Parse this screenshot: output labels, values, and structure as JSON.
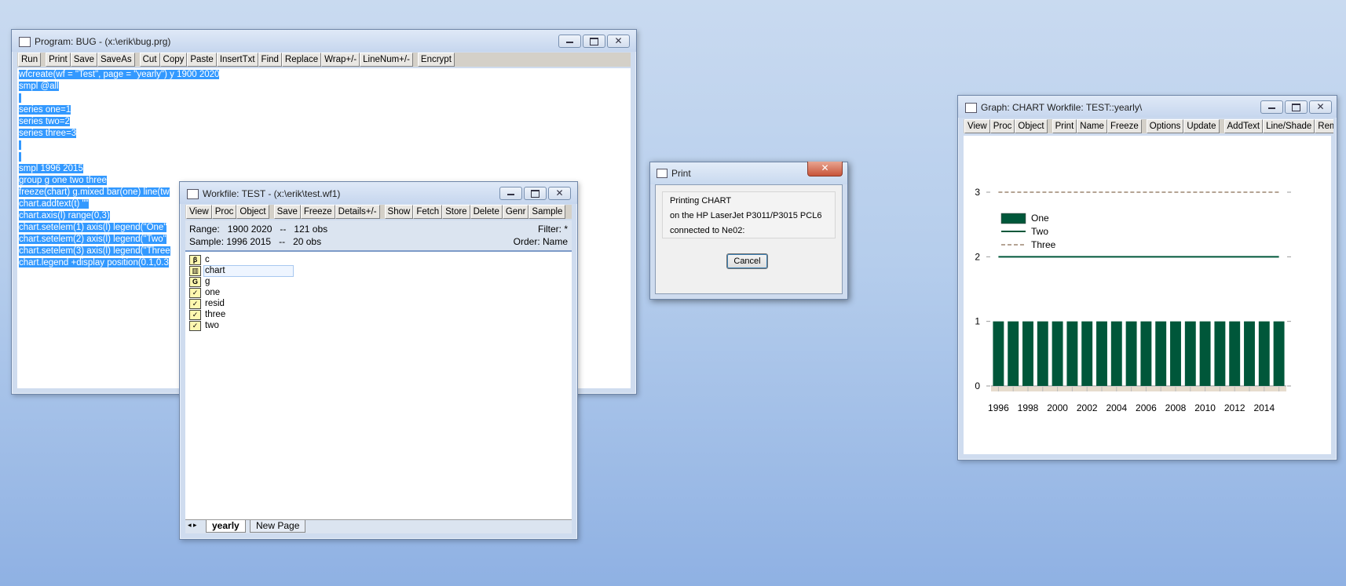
{
  "program": {
    "title": "Program: BUG - (x:\\erik\\bug.prg)",
    "toolbar": [
      "Run",
      "Print",
      "Save",
      "SaveAs",
      "Cut",
      "Copy",
      "Paste",
      "InsertTxt",
      "Find",
      "Replace",
      "Wrap+/-",
      "LineNum+/-",
      "Encrypt"
    ],
    "lines": [
      "wfcreate(wf = \"Test\", page = \"yearly\") y 1900 2020",
      "smpl @all",
      " ",
      "series one=1",
      "series two=2",
      "series three=3",
      " ",
      " ",
      "smpl 1996 2015",
      "group g one two three",
      "freeze(chart) g.mixed bar(one) line(tw",
      "chart.addtext(t) \"\"",
      "chart.axis(l) range(0,3)",
      "chart.setelem(1) axis(l) legend(\"One\"",
      "chart.setelem(2) axis(l) legend(\"Two\"",
      "chart.setelem(3) axis(l) legend(\"Three",
      "chart.legend +display position(0.1,0.3"
    ]
  },
  "workfile": {
    "title": "Workfile: TEST - (x:\\erik\\test.wf1)",
    "toolbar": [
      "View",
      "Proc",
      "Object",
      "Save",
      "Freeze",
      "Details+/-",
      "Show",
      "Fetch",
      "Store",
      "Delete",
      "Genr",
      "Sample"
    ],
    "range_text": "Range:   1900 2020   --   121 obs",
    "filter_text": "Filter: *",
    "sample_text": "Sample: 1996 2015   --   20 obs",
    "order_text": "Order: Name",
    "objects": [
      {
        "icon": "β",
        "name": "c",
        "icon_name": "coefficient-icon"
      },
      {
        "icon": "▥",
        "name": "chart",
        "icon_name": "graph-icon"
      },
      {
        "icon": "G",
        "name": "g",
        "icon_name": "group-icon"
      },
      {
        "icon": "✓",
        "name": "one",
        "icon_name": "series-icon"
      },
      {
        "icon": "✓",
        "name": "resid",
        "icon_name": "series-icon"
      },
      {
        "icon": "✓",
        "name": "three",
        "icon_name": "series-icon"
      },
      {
        "icon": "✓",
        "name": "two",
        "icon_name": "series-icon"
      }
    ],
    "tabs": [
      "yearly",
      "New Page"
    ]
  },
  "print_dialog": {
    "title": "Print",
    "line1": "Printing CHART",
    "line2": "on the HP LaserJet P3011/P3015 PCL6",
    "line3": "connected to Ne02:",
    "cancel_label": "Cancel"
  },
  "graph": {
    "title": "Graph: CHART   Workfile: TEST::yearly\\",
    "toolbar": [
      "View",
      "Proc",
      "Object",
      "Print",
      "Name",
      "Freeze",
      "Options",
      "Update",
      "AddText",
      "Line/Shade",
      "Remo"
    ]
  },
  "colors": {
    "bar": "#00573a",
    "line_two": "#00573a",
    "line_three": "#6b4a2a",
    "selection": "#3399ff"
  },
  "chart_data": {
    "type": "bar",
    "categories": [
      "1996",
      "1997",
      "1998",
      "1999",
      "2000",
      "2001",
      "2002",
      "2003",
      "2004",
      "2005",
      "2006",
      "2007",
      "2008",
      "2009",
      "2010",
      "2011",
      "2012",
      "2013",
      "2014",
      "2015"
    ],
    "xtick_labels": [
      "1996",
      "1998",
      "2000",
      "2002",
      "2004",
      "2006",
      "2008",
      "2010",
      "2012",
      "2014"
    ],
    "series": [
      {
        "name": "One",
        "type": "bar",
        "values": [
          1,
          1,
          1,
          1,
          1,
          1,
          1,
          1,
          1,
          1,
          1,
          1,
          1,
          1,
          1,
          1,
          1,
          1,
          1,
          1
        ]
      },
      {
        "name": "Two",
        "type": "line",
        "values": [
          2,
          2,
          2,
          2,
          2,
          2,
          2,
          2,
          2,
          2,
          2,
          2,
          2,
          2,
          2,
          2,
          2,
          2,
          2,
          2
        ]
      },
      {
        "name": "Three",
        "type": "line-dashed",
        "values": [
          3,
          3,
          3,
          3,
          3,
          3,
          3,
          3,
          3,
          3,
          3,
          3,
          3,
          3,
          3,
          3,
          3,
          3,
          3,
          3
        ]
      }
    ],
    "ylim": [
      0,
      3
    ],
    "yticks": [
      0,
      1,
      2,
      3
    ],
    "legend_position": "upper-left",
    "grid": false,
    "title": "",
    "xlabel": "",
    "ylabel": ""
  }
}
